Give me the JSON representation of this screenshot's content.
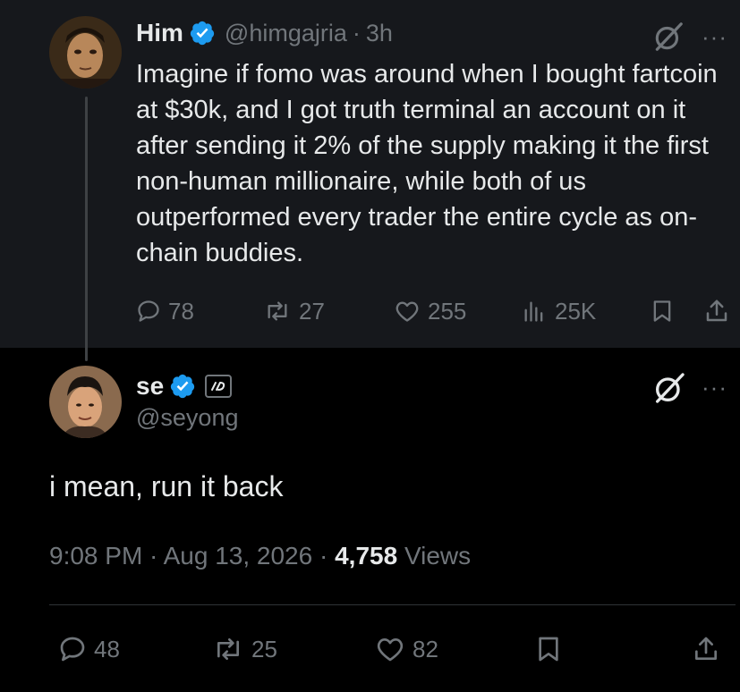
{
  "parent": {
    "name": "Him",
    "handle": "@himgajria",
    "separator": "·",
    "time": "3h",
    "text": "Imagine if fomo was around when I bought fartcoin at $30k, and I got truth terminal an account on it after sending it 2% of the supply making it the first non-human millionaire, while both of us outperformed every trader the entire cycle as on-chain buddies.",
    "more": "···",
    "stats": {
      "replies": "78",
      "reposts": "27",
      "likes": "255",
      "views": "25K"
    }
  },
  "reply": {
    "name": "se",
    "handle": "@seyong",
    "more": "···",
    "text": "i mean, run it back",
    "timestamp": "9:08 PM · Aug 13, 2026 · ",
    "views_count": "4,758",
    "views_label": " Views",
    "stats": {
      "replies": "48",
      "reposts": "25",
      "likes": "82"
    }
  },
  "colors": {
    "background": "#000000",
    "parent_background": "#16181c",
    "text": "#e7e9ea",
    "muted": "#71767b",
    "verified": "#1d9bf0",
    "divider": "#2f3336"
  },
  "icons": [
    "verified-badge-icon",
    "grok-icon",
    "more-icon",
    "reply-icon",
    "repost-icon",
    "like-icon",
    "views-icon",
    "bookmark-icon",
    "share-icon",
    "affiliate-badge-icon"
  ]
}
